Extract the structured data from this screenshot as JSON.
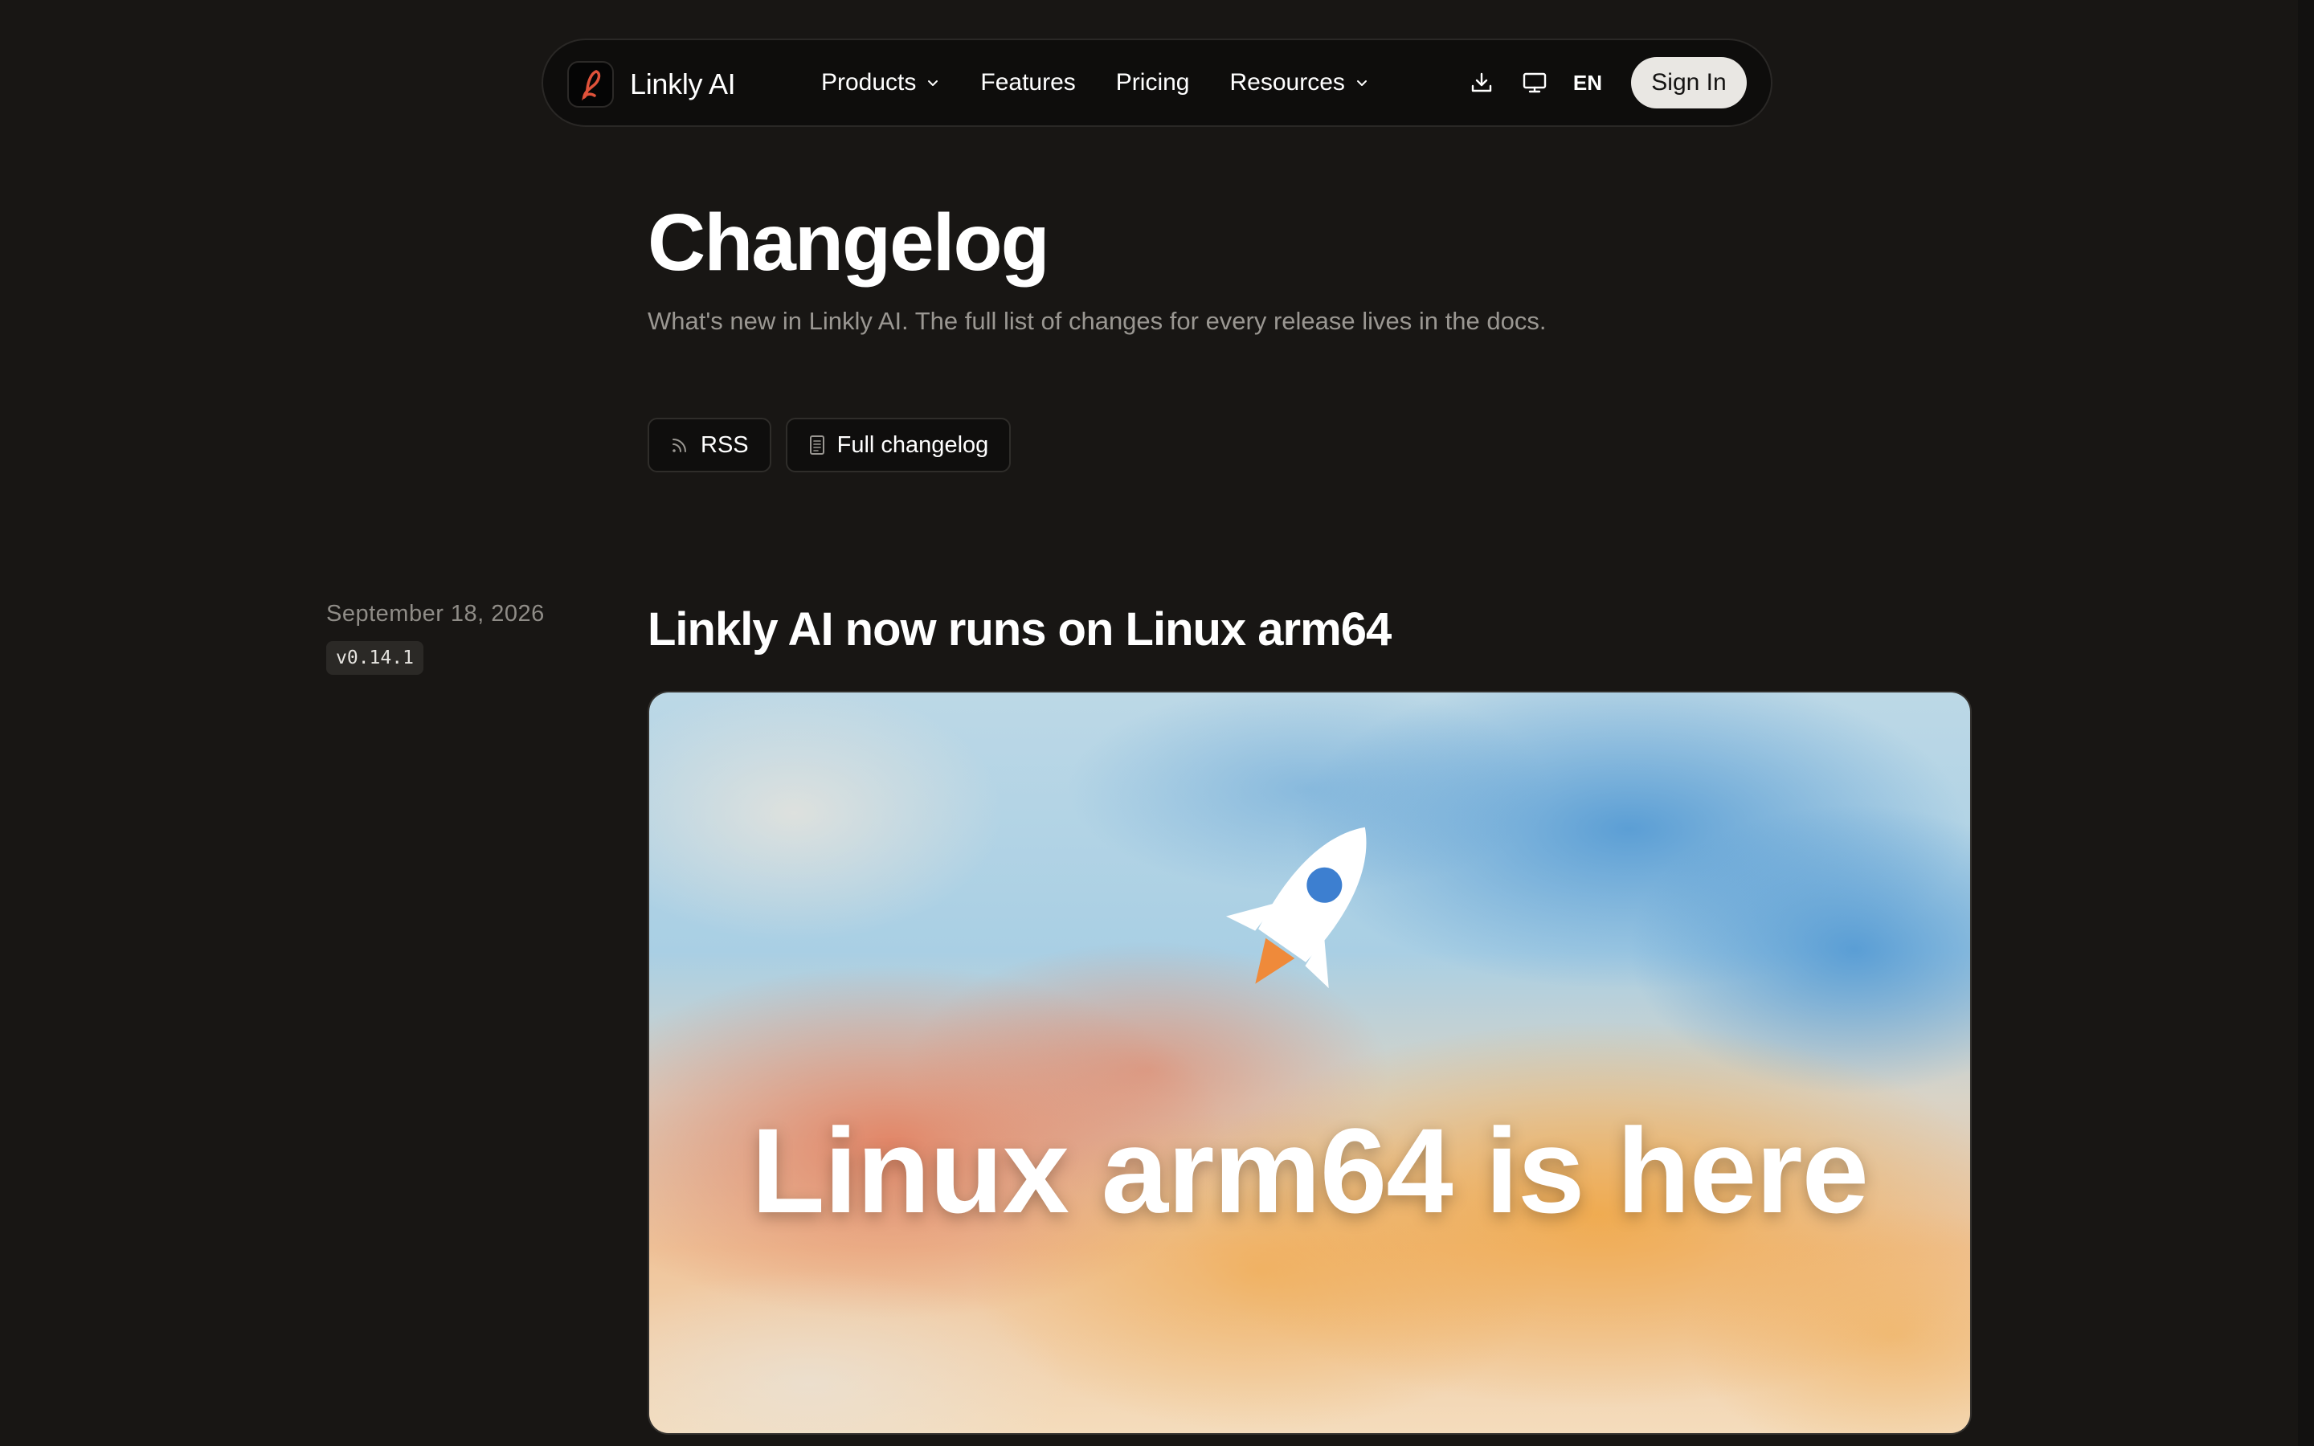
{
  "nav": {
    "brand": "Linkly AI",
    "links": [
      {
        "label": "Products",
        "has_dropdown": true
      },
      {
        "label": "Features",
        "has_dropdown": false
      },
      {
        "label": "Pricing",
        "has_dropdown": false
      },
      {
        "label": "Resources",
        "has_dropdown": true
      }
    ],
    "icons": [
      "download-icon",
      "desktop-icon"
    ],
    "language": "EN",
    "sign_in": "Sign In"
  },
  "header": {
    "title": "Changelog",
    "subtitle": "What's new in Linkly AI. The full list of changes for every release lives in the docs.",
    "buttons": [
      {
        "label": "RSS",
        "icon": "rss-icon"
      },
      {
        "label": "Full changelog",
        "icon": "document-icon"
      }
    ]
  },
  "entries": [
    {
      "date": "September 18, 2026",
      "version": "v0.14.1",
      "title": "Linkly AI now runs on Linux arm64",
      "image_text": "Linux arm64 is here",
      "image_icon": "rocket-icon"
    }
  ],
  "colors": {
    "background": "#181614",
    "nav_background": "#0e0d0c",
    "text_primary": "#ffffff",
    "text_muted": "#9a9792",
    "sign_in_bg": "#e9e7e3",
    "logo_accent": "#e0523a"
  }
}
